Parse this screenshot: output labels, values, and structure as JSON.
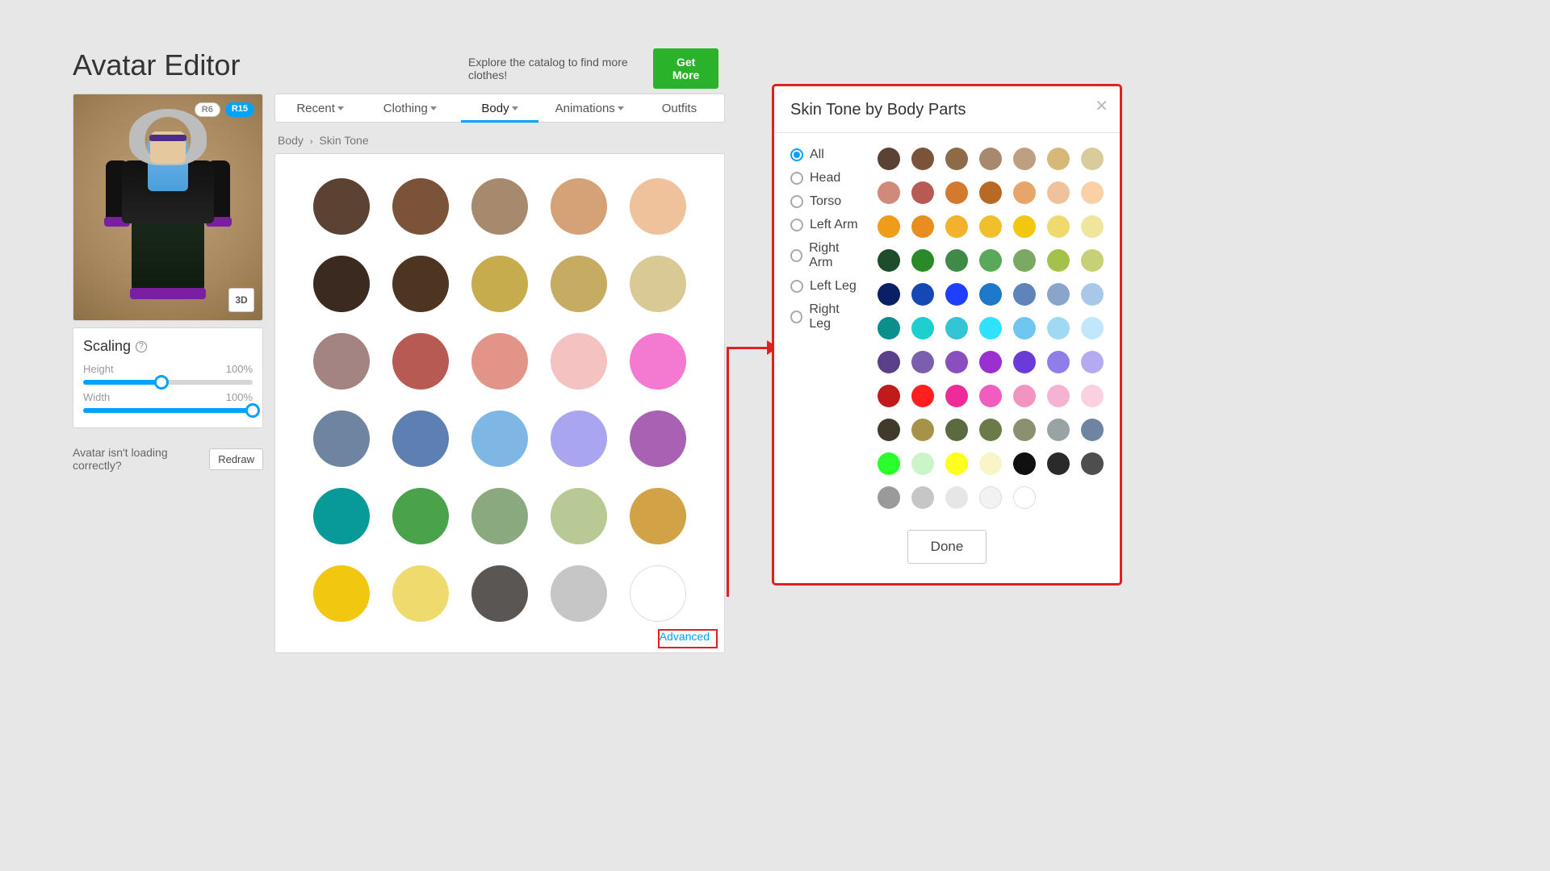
{
  "page_title": "Avatar Editor",
  "catalog": {
    "text": "Explore the catalog to find more clothes!",
    "button": "Get More"
  },
  "rig_chips": {
    "r6": "R6",
    "r15": "R15"
  },
  "preview": {
    "threed_label": "3D"
  },
  "scaling": {
    "title": "Scaling",
    "height_label": "Height",
    "height_value": "100%",
    "height_fill_pct": 46,
    "width_label": "Width",
    "width_value": "100%",
    "width_fill_pct": 100
  },
  "loading_hint": {
    "text": "Avatar isn't loading correctly?",
    "button": "Redraw"
  },
  "tabs": [
    {
      "label": "Recent",
      "has_menu": true,
      "active": false
    },
    {
      "label": "Clothing",
      "has_menu": true,
      "active": false
    },
    {
      "label": "Body",
      "has_menu": true,
      "active": true
    },
    {
      "label": "Animations",
      "has_menu": true,
      "active": false
    },
    {
      "label": "Outfits",
      "has_menu": false,
      "active": false
    }
  ],
  "breadcrumb": {
    "parent": "Body",
    "child": "Skin Tone"
  },
  "swatches": [
    "#5c4232",
    "#7a5338",
    "#a78a6e",
    "#d5a177",
    "#f0c29b",
    "#3a2a20",
    "#4e3521",
    "#c7ac4e",
    "#c6ab63",
    "#d9c995",
    "#a48383",
    "#b85a54",
    "#e29488",
    "#f5c2c2",
    "#f37ad0",
    "#6f84a0",
    "#5e7fb1",
    "#7fb7e4",
    "#a9a5f0",
    "#a861b3",
    "#089999",
    "#4aa24a",
    "#8aa97f",
    "#b9c995",
    "#d2a346",
    "#f2c70f",
    "#efda6d",
    "#5a5654",
    "#c6c6c6",
    "#ffffff"
  ],
  "advanced_label": "Advanced",
  "modal": {
    "title": "Skin Tone by Body Parts",
    "radios": [
      "All",
      "Head",
      "Torso",
      "Left Arm",
      "Right Arm",
      "Left Leg",
      "Right Leg"
    ],
    "selected_radio": "All",
    "done_label": "Done",
    "swatches": [
      "#5c4232",
      "#7a5338",
      "#8d6b47",
      "#a78a6e",
      "#bda081",
      "#d6b978",
      "#d9cc9b",
      "#cf8a7a",
      "#b85a54",
      "#d37a2e",
      "#b86a24",
      "#e8a56b",
      "#f0c29b",
      "#fbd0a6",
      "#f09b1a",
      "#e88e21",
      "#f2b22b",
      "#efbf2e",
      "#f2c70f",
      "#efda6d",
      "#f0e59c",
      "#1f4d2b",
      "#2a8a2a",
      "#3e8a46",
      "#5aa85a",
      "#7aa964",
      "#a4c24b",
      "#c7d074",
      "#0b1f66",
      "#1648b3",
      "#1f3fff",
      "#1f79c9",
      "#5f84b9",
      "#8aa4cc",
      "#a9c7e8",
      "#0a8e8e",
      "#1ecfcf",
      "#33c4d6",
      "#30e2ff",
      "#6fc7f0",
      "#9fd9f2",
      "#c0e7fb",
      "#5a3f8a",
      "#7a5fae",
      "#8a4fbf",
      "#9a30d0",
      "#6a3bd9",
      "#8f7de8",
      "#b4aaf2",
      "#c01a1a",
      "#ff1f1f",
      "#ef2b9a",
      "#f05cc0",
      "#f294c0",
      "#f5b2d2",
      "#fbd0e0",
      "#3f3a2a",
      "#a79347",
      "#5b6b3f",
      "#6c7a4a",
      "#8a9170",
      "#9aa3a3",
      "#6f84a0",
      "#2bff2b",
      "#c9f5c9",
      "#ffff1f",
      "#f9f5c9",
      "#101010",
      "#2a2a2a",
      "#4e4e4e",
      "#9a9a9a",
      "#c6c6c6",
      "#e6e6e6",
      "#f2f2f2",
      "#ffffff"
    ]
  }
}
